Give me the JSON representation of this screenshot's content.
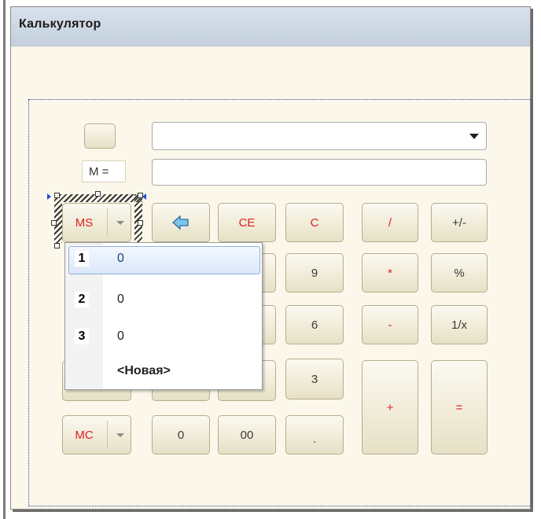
{
  "window": {
    "title": "Калькулятор"
  },
  "top_button": {
    "label": ""
  },
  "memory_label": "M =",
  "display": {
    "value": "",
    "expression": ""
  },
  "buttons": {
    "ms": "MS",
    "backspace_icon": "left-arrow-icon",
    "ce": "CE",
    "c": "C",
    "divide": "/",
    "plus_minus": "+/-",
    "nine": "9",
    "multiply": "*",
    "percent": "%",
    "six": "6",
    "minus": "-",
    "reciprocal": "1/x",
    "three": "3",
    "plus": "+",
    "equals": "=",
    "mc": "MC",
    "zero": "0",
    "double_zero": "00",
    "decimal": "."
  },
  "memory_popup": {
    "items": [
      {
        "index": "1",
        "value": "0",
        "selected": true
      },
      {
        "index": "2",
        "value": "0",
        "selected": false
      },
      {
        "index": "3",
        "value": "0",
        "selected": false
      }
    ],
    "new_item": "<Новая>"
  },
  "colors": {
    "title_bar": "#c9d4e1",
    "form_background": "#fbf7ea",
    "operator_text": "#e02020",
    "selection_highlight": "#dbe8f8"
  }
}
